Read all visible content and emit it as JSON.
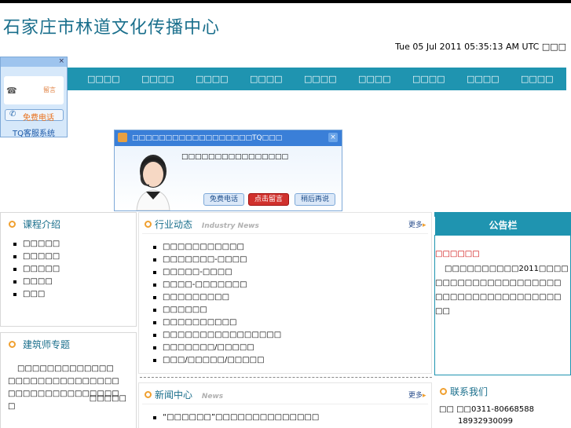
{
  "site": {
    "title": "石家庄市林道文化传播中心",
    "datetime": "Tue 05 Jul 2011 05:35:13 AM UTC □□□"
  },
  "nav": {
    "items": [
      "□□□□",
      "□□□□",
      "□□□□",
      "□□□□",
      "□□□□",
      "□□□□",
      "□□□□",
      "□□□□",
      "□□□□"
    ]
  },
  "kefu": {
    "leave": "留言",
    "call_label": "免费电话",
    "footer": "TQ客服系统",
    "close": "×"
  },
  "popup": {
    "title": "□□□□□□□□□□□□□□□□□□TQ□□□",
    "message": "□□□□□□□□□□□□□□□□",
    "close": "×",
    "buttons": [
      "免费电话",
      "点击留言",
      "稍后再说"
    ]
  },
  "courses": {
    "title": "课程介绍",
    "items": [
      "□□□□□",
      "□□□□□",
      "□□□□□",
      "□□□□",
      "□□□"
    ]
  },
  "architect": {
    "title": "建筑师专题",
    "text": "□□□□□□□□□□□□□□□□□□□□□□□□□□□□□□□□□□□□□□□□□□□□",
    "more": "□□□□□"
  },
  "industry": {
    "title": "行业动态",
    "subtitle": "Industry News",
    "more": "更多",
    "items": [
      "□□□□□□□□□□□",
      "□□□□□□□-□□□□",
      "□□□□□-□□□□",
      "□□□□-□□□□□□□",
      "□□□□□□□□□",
      "□□□□□□",
      "□□□□□□□□□□",
      "□□□□□□□□□□□□□□□□",
      "□□□□□□□/□□□□□",
      "□□□/□□□□□/□□□□□"
    ]
  },
  "news": {
    "title": "新闻中心",
    "subtitle": "News",
    "more": "更多",
    "items": [
      "“□□□□□□”□□□□□□□□□□□□□□"
    ]
  },
  "notice": {
    "title": "公告栏",
    "highlight": "□□□□□□",
    "text": "□□□□□□□□□□2011□□□□□□□□□□□□□□□□□□□□□□□□□□□□□□□□□□□□□□□□"
  },
  "contact": {
    "title": "联系我们",
    "phone": "□□ □□0311-80668588",
    "mobile": "18932930099"
  },
  "colors": {
    "nav": "#1f94b0",
    "title": "#1a6f8c",
    "accent": "#f0a030",
    "alert": "#cc0000"
  }
}
